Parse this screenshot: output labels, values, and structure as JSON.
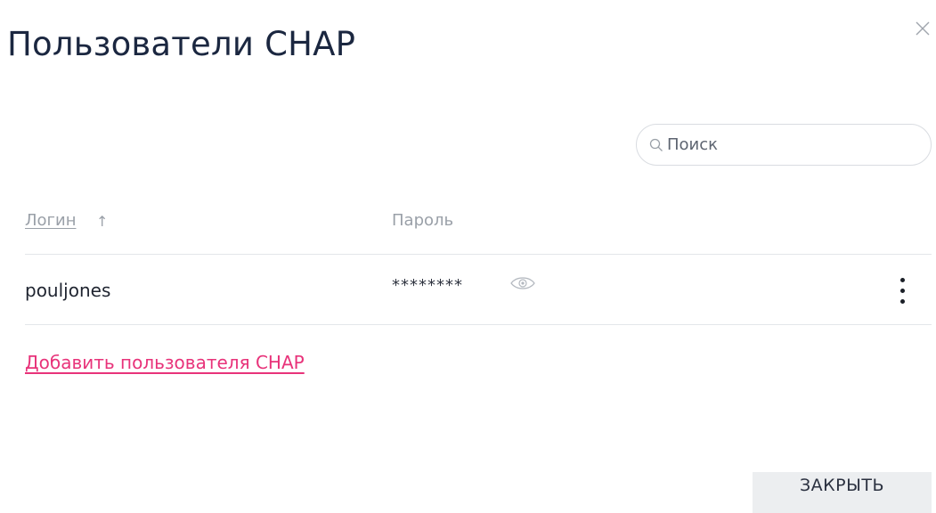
{
  "dialog": {
    "title": "Пользователи CHAP",
    "close_icon": "close-icon"
  },
  "search": {
    "placeholder": "Поиск",
    "icon": "search-icon"
  },
  "table": {
    "columns": [
      {
        "label": "Логин",
        "sort_indicator": "↑",
        "sortable": true
      },
      {
        "label": "Пароль"
      }
    ],
    "rows": [
      {
        "login": "pouljones",
        "password_masked": "********",
        "reveal_icon": "eye-icon",
        "menu_icon": "kebab-menu-icon"
      }
    ]
  },
  "actions": {
    "add_link": "Добавить пользователя CHAP",
    "close_button": "ЗАКРЫТЬ"
  },
  "colors": {
    "title": "#1b2740",
    "accent_link": "#e8337a",
    "muted_header": "#9aa0a8",
    "divider": "#e3e6ea",
    "button_bg": "#eceef0"
  }
}
